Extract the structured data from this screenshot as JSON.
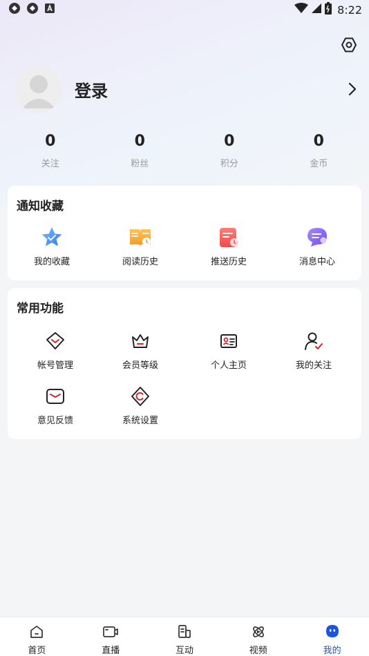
{
  "status_bar": {
    "time": "8:22"
  },
  "profile": {
    "login_label": "登录"
  },
  "stats": [
    {
      "value": "0",
      "label": "关注"
    },
    {
      "value": "0",
      "label": "粉丝"
    },
    {
      "value": "0",
      "label": "积分"
    },
    {
      "value": "0",
      "label": "金币"
    }
  ],
  "notify_section": {
    "title": "通知收藏",
    "items": [
      {
        "label": "我的收藏",
        "icon": "star-icon"
      },
      {
        "label": "阅读历史",
        "icon": "book-history-icon"
      },
      {
        "label": "推送历史",
        "icon": "push-history-icon"
      },
      {
        "label": "消息中心",
        "icon": "message-icon"
      }
    ]
  },
  "functions_section": {
    "title": "常用功能",
    "items": [
      {
        "label": "帐号管理",
        "icon": "account-icon"
      },
      {
        "label": "会员等级",
        "icon": "crown-icon"
      },
      {
        "label": "个人主页",
        "icon": "id-card-icon"
      },
      {
        "label": "我的关注",
        "icon": "follow-icon"
      },
      {
        "label": "意见反馈",
        "icon": "mail-icon"
      },
      {
        "label": "系统设置",
        "icon": "settings-icon"
      }
    ]
  },
  "bottom_nav": [
    {
      "label": "首页",
      "icon": "home-icon",
      "active": false
    },
    {
      "label": "直播",
      "icon": "live-icon",
      "active": false
    },
    {
      "label": "互动",
      "icon": "interact-icon",
      "active": false
    },
    {
      "label": "视频",
      "icon": "video-icon",
      "active": false
    },
    {
      "label": "我的",
      "icon": "mine-icon",
      "active": true
    }
  ],
  "colors": {
    "accent": "#1a56db",
    "accent_red": "#d8232a",
    "background": "#f4f5f7"
  }
}
